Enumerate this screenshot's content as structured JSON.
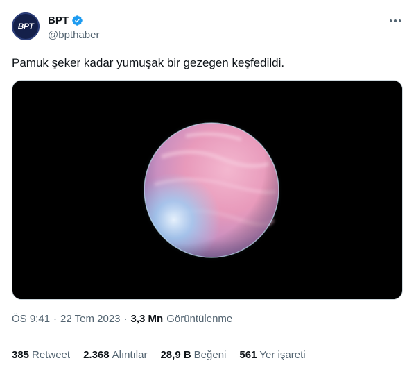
{
  "author": {
    "avatar_text": "BPT",
    "display_name": "BPT",
    "handle": "@bpthaber",
    "verified_icon": "verified-badge-icon",
    "verified_color": "#1d9bf0"
  },
  "tweet": {
    "text": "Pamuk şeker kadar yumuşak bir gezegen keşfedildi.",
    "image_alt": "cotton-candy-planet-image"
  },
  "meta": {
    "time": "ÖS 9:41",
    "separator1": "·",
    "date": "22 Tem 2023",
    "separator2": "·",
    "views_count": "3,3 Mn",
    "views_label": "Görüntülenme"
  },
  "stats": [
    {
      "count": "385",
      "label": "Retweet"
    },
    {
      "count": "2.368",
      "label": "Alıntılar"
    },
    {
      "count": "28,9 B",
      "label": "Beğeni"
    },
    {
      "count": "561",
      "label": "Yer işareti"
    }
  ],
  "colors": {
    "text_primary": "#0f1419",
    "text_secondary": "#536471",
    "accent": "#1d9bf0"
  }
}
